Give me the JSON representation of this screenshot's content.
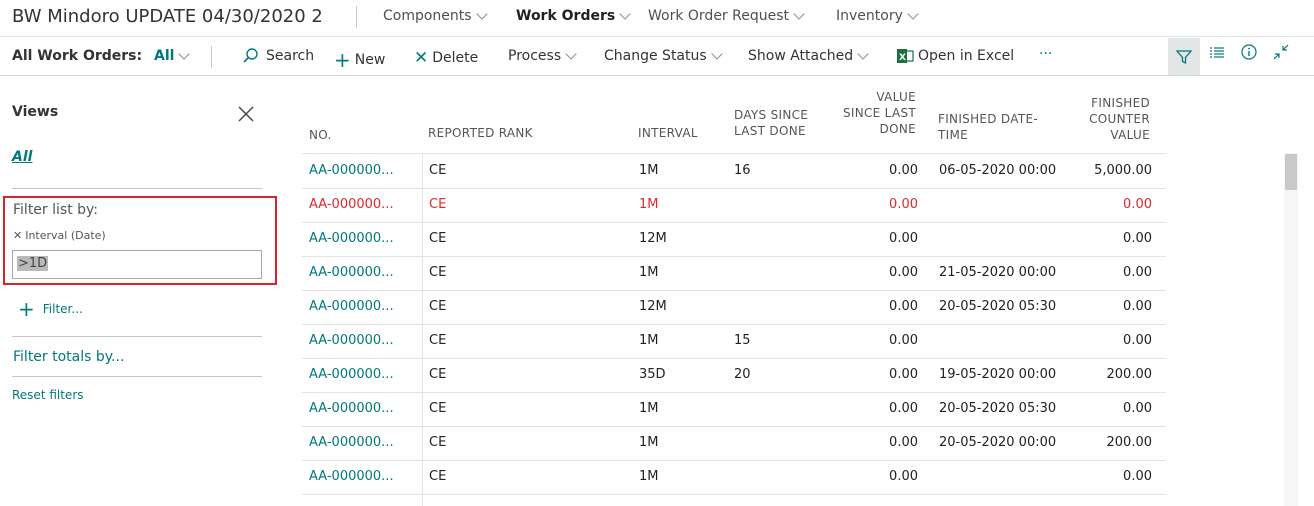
{
  "company": "BW Mindoro UPDATE 04/30/2020 2",
  "nav": [
    {
      "label": "Components"
    },
    {
      "label": "Work Orders"
    },
    {
      "label": "Work Order Request"
    },
    {
      "label": "Inventory"
    }
  ],
  "actionbar": {
    "list_label": "All Work Orders:",
    "view_selector": "All",
    "search": "Search",
    "new": "New",
    "delete": "Delete",
    "process": "Process",
    "change_status": "Change Status",
    "show_attached": "Show Attached",
    "open_excel": "Open in Excel",
    "more": "···"
  },
  "pane": {
    "title": "Views",
    "view_all": "All",
    "filter_list_by": "Filter list by:",
    "filter_field": "Interval (Date)",
    "filter_value": ">1D",
    "add_filter": "Filter...",
    "filter_totals": "Filter totals by...",
    "reset": "Reset filters"
  },
  "table": {
    "columns": {
      "no": "NO.",
      "rank": "REPORTED RANK",
      "interval": "INTERVAL",
      "days_1": "DAYS SINCE",
      "days_2": "LAST DONE",
      "value_1": "VALUE",
      "value_2": "SINCE LAST",
      "value_3": "DONE",
      "finished_1": "FINISHED DATE-",
      "finished_2": "TIME",
      "counter_1": "FINISHED",
      "counter_2": "COUNTER",
      "counter_3": "VALUE"
    },
    "rows": [
      {
        "no": "AA-000000...",
        "rank": "CE",
        "interval": "1M",
        "days": "16",
        "value": "0.00",
        "finished": "06-05-2020 00:00",
        "counter": "5,000.00"
      },
      {
        "no": "AA-000000...",
        "rank": "CE",
        "interval": "1M",
        "days": "",
        "value": "0.00",
        "finished": "",
        "counter": "0.00"
      },
      {
        "no": "AA-000000...",
        "rank": "CE",
        "interval": "12M",
        "days": "",
        "value": "0.00",
        "finished": "",
        "counter": "0.00"
      },
      {
        "no": "AA-000000...",
        "rank": "CE",
        "interval": "1M",
        "days": "",
        "value": "0.00",
        "finished": "21-05-2020 00:00",
        "counter": "0.00"
      },
      {
        "no": "AA-000000...",
        "rank": "CE",
        "interval": "12M",
        "days": "",
        "value": "0.00",
        "finished": "20-05-2020 05:30",
        "counter": "0.00"
      },
      {
        "no": "AA-000000...",
        "rank": "CE",
        "interval": "1M",
        "days": "15",
        "value": "0.00",
        "finished": "",
        "counter": "0.00"
      },
      {
        "no": "AA-000000...",
        "rank": "CE",
        "interval": "35D",
        "days": "20",
        "value": "0.00",
        "finished": "19-05-2020 00:00",
        "counter": "200.00"
      },
      {
        "no": "AA-000000...",
        "rank": "CE",
        "interval": "1M",
        "days": "",
        "value": "0.00",
        "finished": "20-05-2020 05:30",
        "counter": "0.00"
      },
      {
        "no": "AA-000000...",
        "rank": "CE",
        "interval": "1M",
        "days": "",
        "value": "0.00",
        "finished": "20-05-2020 00:00",
        "counter": "200.00"
      },
      {
        "no": "AA-000000...",
        "rank": "CE",
        "interval": "1M",
        "days": "",
        "value": "0.00",
        "finished": "",
        "counter": "0.00"
      }
    ]
  },
  "colors": {
    "accent": "#00797d",
    "error": "#e2262e",
    "highlight_box": "#d9232d"
  }
}
